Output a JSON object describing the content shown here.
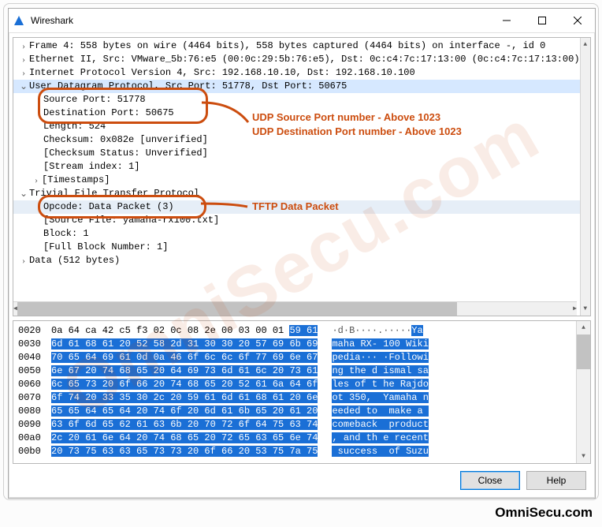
{
  "window": {
    "title": "Wireshark"
  },
  "tree": {
    "frame": "Frame 4: 558 bytes on wire (4464 bits), 558 bytes captured (4464 bits) on interface -, id 0",
    "eth": "Ethernet II, Src: VMware_5b:76:e5 (00:0c:29:5b:76:e5), Dst: 0c:c4:7c:17:13:00 (0c:c4:7c:17:13:00)",
    "ip": "Internet Protocol Version 4, Src: 192.168.10.10, Dst: 192.168.10.100",
    "udp": "User Datagram Protocol, Src Port: 51778, Dst Port: 50675",
    "udp_src": "Source Port: 51778",
    "udp_dst": "Destination Port: 50675",
    "udp_len": "Length: 524",
    "udp_cks": "Checksum: 0x082e [unverified]",
    "udp_cst": "[Checksum Status: Unverified]",
    "udp_si": "[Stream index: 1]",
    "udp_ts": "[Timestamps]",
    "tftp": "Trivial File Transfer Protocol",
    "tftp_op": "Opcode: Data Packet (3)",
    "tftp_src": "[Source File: yamaha-rx100.txt]",
    "tftp_blk": "Block: 1",
    "tftp_fbn": "[Full Block Number: 1]",
    "data": "Data (512 bytes)"
  },
  "hex": [
    {
      "off": "0020",
      "plain": "0a 64 ca 42 c5 f3 02 0c 08 2e 00 03 00 01 ",
      "hl": "59 61",
      "aplain": "·d·B····.·····",
      "ahl": "Ya"
    },
    {
      "off": "0030",
      "plain": "",
      "hl": "6d 61 68 61 20 52 58 2d 31 30 30 20 57 69 6b 69",
      "aplain": "",
      "ahl": "maha RX- 100 Wiki"
    },
    {
      "off": "0040",
      "plain": "",
      "hl": "70 65 64 69 61 0d 0a 46 6f 6c 6c 6f 77 69 6e 67",
      "aplain": "",
      "ahl": "pedia··· ·Followi"
    },
    {
      "off": "0050",
      "plain": "",
      "hl": "6e 67 20 74 68 65 20 64 69 73 6d 61 6c 20 73 61",
      "aplain": "",
      "ahl": "ng the d ismal sa"
    },
    {
      "off": "0060",
      "plain": "",
      "hl": "6c 65 73 20 6f 66 20 74 68 65 20 52 61 6a 64 6f",
      "aplain": "",
      "ahl": "les of t he Rajdo"
    },
    {
      "off": "0070",
      "plain": "",
      "hl": "6f 74 20 33 35 30 2c 20 59 61 6d 61 68 61 20 6e",
      "aplain": "",
      "ahl": "ot 350,  Yamaha n"
    },
    {
      "off": "0080",
      "plain": "",
      "hl": "65 65 64 65 64 20 74 6f 20 6d 61 6b 65 20 61 20",
      "aplain": "",
      "ahl": "eeded to  make a "
    },
    {
      "off": "0090",
      "plain": "",
      "hl": "63 6f 6d 65 62 61 63 6b 20 70 72 6f 64 75 63 74",
      "aplain": "",
      "ahl": "comeback  product"
    },
    {
      "off": "00a0",
      "plain": "",
      "hl": "2c 20 61 6e 64 20 74 68 65 20 72 65 63 65 6e 74",
      "aplain": "",
      "ahl": ", and th e recent"
    },
    {
      "off": "00b0",
      "plain": "",
      "hl": "20 73 75 63 63 65 73 73 20 6f 66 20 53 75 7a 75",
      "aplain": "",
      "ahl": " success  of Suzu"
    }
  ],
  "buttons": {
    "close": "Close",
    "help": "Help"
  },
  "annotations": {
    "udp_ports_1": "UDP Source Port number - Above 1023",
    "udp_ports_2": "UDP Destination Port number - Above 1023",
    "tftp": "TFTP Data Packet"
  },
  "branding": "OmniSecu.com",
  "watermark": "OmniSecu.com"
}
